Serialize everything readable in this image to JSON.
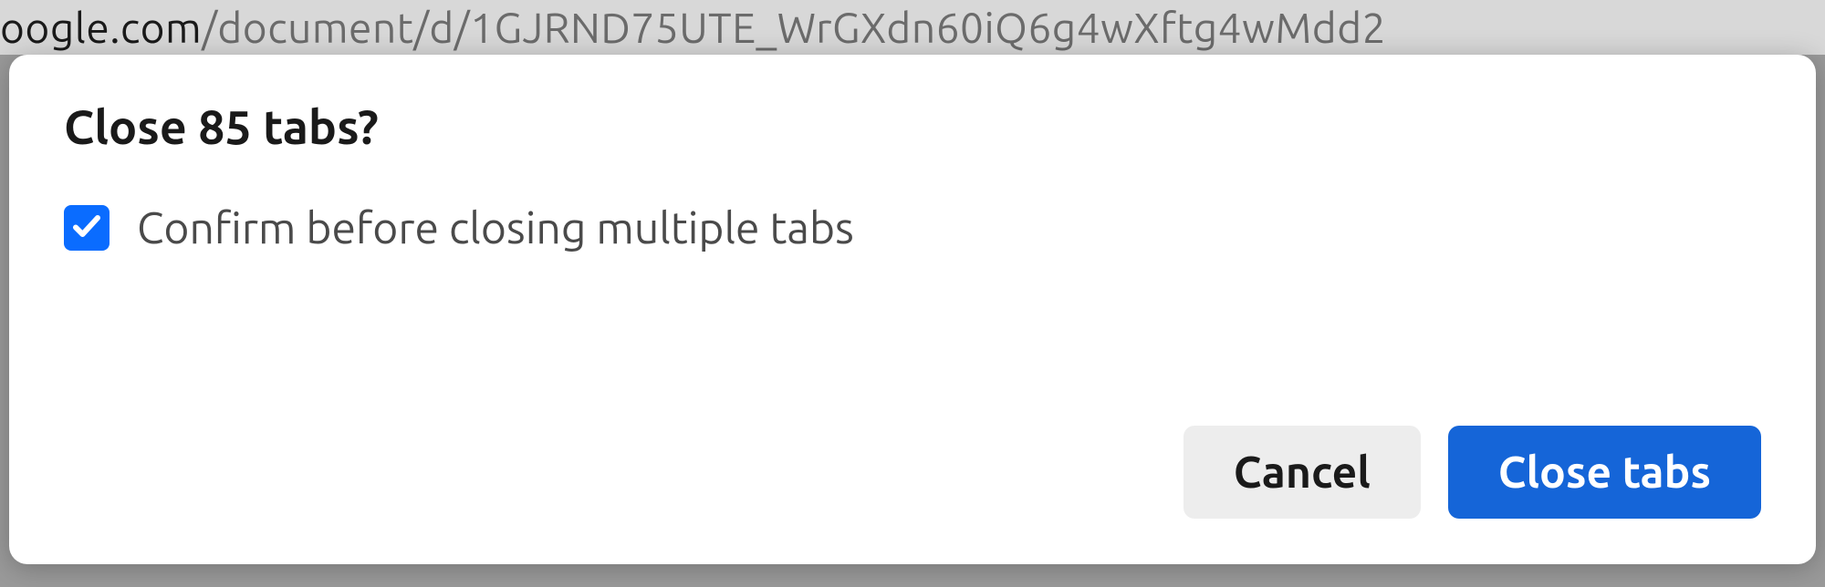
{
  "url": {
    "domain_fragment": "oogle.com",
    "path_fragment": "/document/d/1GJRND75UTE_WrGXdn60iQ6g4wXftg4wMdd2"
  },
  "dialog": {
    "title": "Close 85 tabs?",
    "checkbox_label": "Confirm before closing multiple tabs",
    "checkbox_checked": true,
    "cancel_label": "Cancel",
    "confirm_label": "Close tabs"
  }
}
